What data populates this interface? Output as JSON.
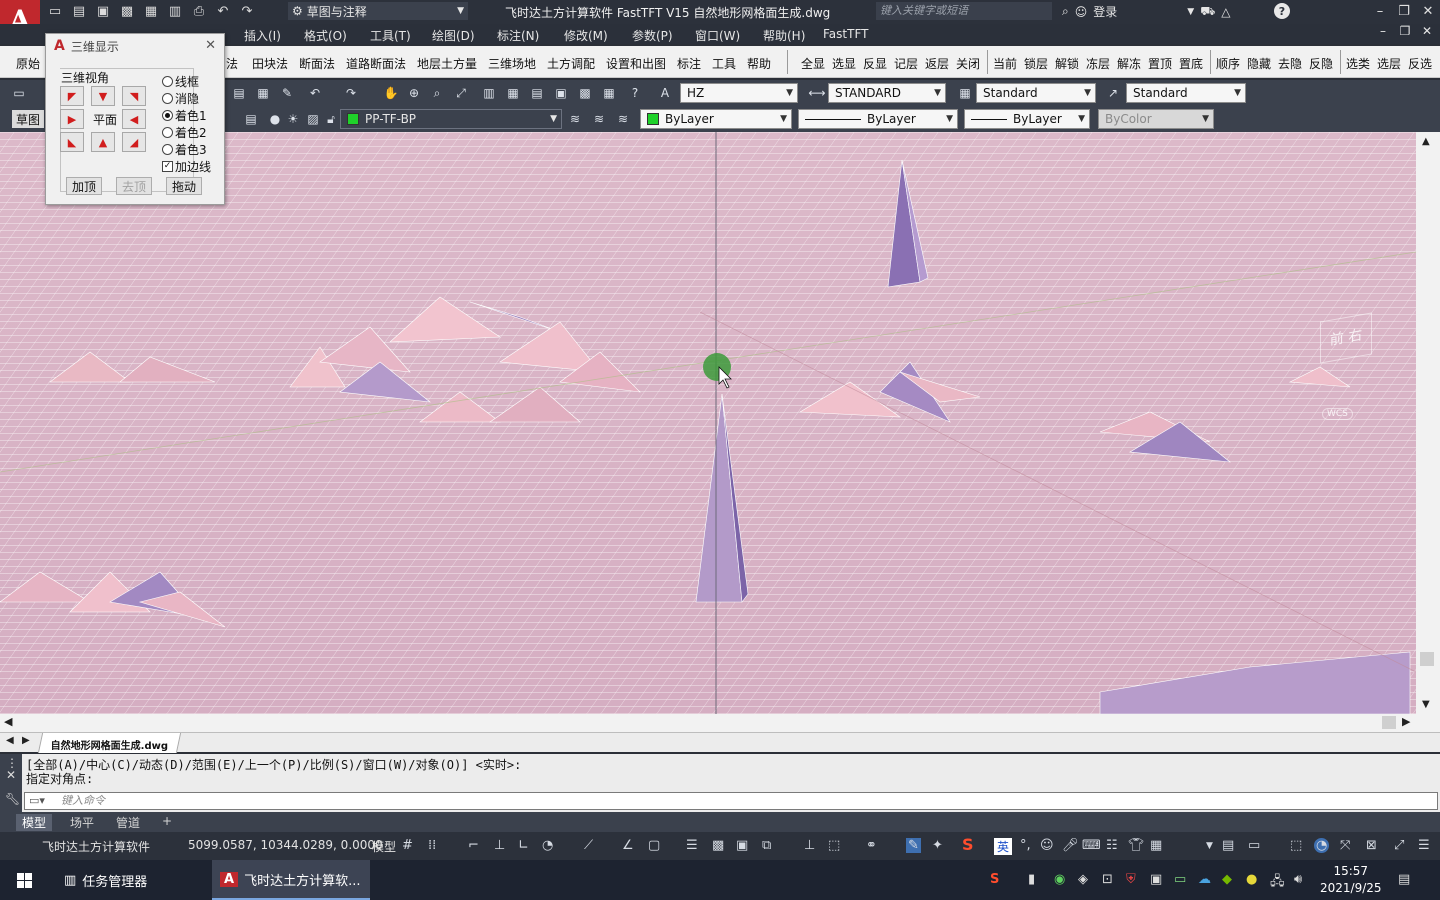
{
  "titlebar": {
    "app_logo": "A",
    "workspace": "草图与注释",
    "title": "飞时达土方计算软件 FastTFT V15    自然地形网格面生成.dwg",
    "search_placeholder": "键入关键字或短语",
    "login": "登录"
  },
  "menubar": {
    "items": [
      "插入(I)",
      "格式(O)",
      "工具(T)",
      "绘图(D)",
      "标注(N)",
      "修改(M)",
      "参数(P)",
      "窗口(W)",
      "帮助(H)",
      "FastTFT"
    ]
  },
  "cmdrow": {
    "left": [
      "原始",
      "法",
      "田块法",
      "断面法",
      "道路断面法",
      "地层土方量",
      "三维场地",
      "土方调配",
      "设置和出图",
      "标注",
      "工具",
      "帮助"
    ],
    "right": [
      "全显",
      "选显",
      "反显",
      "记层",
      "返层",
      "关闭",
      "当前",
      "锁层",
      "解锁",
      "冻层",
      "解冻",
      "置顶",
      "置底",
      "顺序",
      "隐藏",
      "去隐",
      "反隐",
      "选类",
      "选层",
      "反选"
    ]
  },
  "toolbar": {
    "text_style": "HZ",
    "dim_style": "STANDARD",
    "table_style": "Standard",
    "mleader_style": "Standard",
    "side_tab": "草图",
    "layer": "PP-TF-BP",
    "color": "ByLayer",
    "linetype": "ByLayer",
    "lineweight": "ByLayer",
    "plotstyle": "ByColor"
  },
  "dialog": {
    "title": "三维显示",
    "group_label": "三维视角",
    "plane_label": "平面",
    "radios": [
      {
        "label": "线框",
        "checked": false
      },
      {
        "label": "消隐",
        "checked": false
      },
      {
        "label": "着色1",
        "checked": true
      },
      {
        "label": "着色2",
        "checked": false
      },
      {
        "label": "着色3",
        "checked": false
      }
    ],
    "edge_checkbox": {
      "label": "加边线",
      "checked": true
    },
    "buttons": [
      "加顶",
      "去顶",
      "拖动"
    ]
  },
  "viewport": {
    "viewcube_label": "前 右",
    "wcs_label": "WCS",
    "surface_color": "#d9b4c6"
  },
  "filetabs": {
    "active_file": "自然地形网格面生成.dwg"
  },
  "commandline": {
    "history_1": "[全部(A)/中心(C)/动态(D)/范围(E)/上一个(P)/比例(S)/窗口(W)/对象(O)] <实时>:",
    "history_2": "指定对角点:",
    "placeholder": "键入命令"
  },
  "layouttabs": [
    "模型",
    "场平",
    "管道"
  ],
  "statusbar": {
    "app_name": "飞时达土方计算软件",
    "coordinates": "5099.0587, 10344.0289, 0.0000",
    "mode": "模型",
    "ime": "英"
  },
  "taskbar": {
    "task_manager": "任务管理器",
    "active_app": "飞时达土方计算软...",
    "time": "15:57",
    "date": "2021/9/25"
  }
}
